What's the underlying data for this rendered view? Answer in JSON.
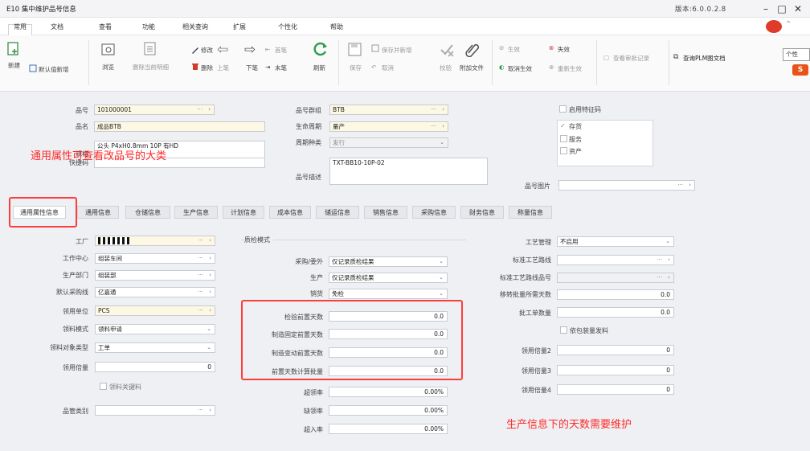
{
  "window": {
    "title": "E10 集中维护品号信息",
    "version": "版本:6.0.0.2.8",
    "min": "–",
    "max": "□",
    "close": "✕"
  },
  "menu": [
    "常用",
    "文档",
    "查看",
    "功能",
    "相关查询",
    "扩展",
    "个性化",
    "帮助"
  ],
  "ribbon": {
    "new": "新建",
    "default_new": "默认值新增",
    "browse": "浏览",
    "delete_current": "删除当前明细",
    "edit": "修改",
    "delete": "删除",
    "prev": "上笔",
    "next": "下笔",
    "first": "首笔",
    "last": "末笔",
    "refresh": "刷新",
    "save": "保存",
    "save_new": "保存并新增",
    "cancel": "取消",
    "check": "校验",
    "attach": "附加文件",
    "effective": "生效",
    "cancel_effective": "取消生效",
    "invalid": "失效",
    "re_effective": "重新生效",
    "view_audit": "查看审批记录",
    "query_plm": "查询PLM图文档",
    "tooltip": "个性"
  },
  "form": {
    "item_no_label": "品号",
    "item_no": "101000001",
    "item_name_label": "品名",
    "item_name": "成品BTB",
    "spec_label": "规格",
    "spec": "公头 P4xH0.8mm 10P 有HD",
    "quick_label": "快捷码",
    "quick": "",
    "group_label": "品号群组",
    "group": "BTB",
    "lifecycle_label": "生命周期",
    "lifecycle": "量产",
    "cycle_type_label": "周期种类",
    "cycle_type": "发行",
    "desc_label": "品号描述",
    "desc": "TXT-BB10-10P-02",
    "feature_label": "启用特征码",
    "stock_label": "存货",
    "service_label": "服务",
    "asset_label": "资产",
    "picture_label": "品号图片"
  },
  "annotation_top": "通用属性可查看改品号的大类",
  "annotation_bottom": "生产信息下的天数需要维护",
  "tabs": [
    "通用属性信息",
    "通用信息",
    "仓储信息",
    "生产信息",
    "计划信息",
    "成本信息",
    "储运信息",
    "销售信息",
    "采购信息",
    "财务信息",
    "称量信息"
  ],
  "prod": {
    "factory_label": "工厂",
    "factory": "",
    "work_center_label": "工作中心",
    "work_center": "组装车间",
    "dept_label": "生产部门",
    "dept": "组装部",
    "line_label": "默认采购线",
    "line": "亿嘉通",
    "unit_label": "领用单位",
    "unit": "PCS",
    "pick_mode_label": "领料模式",
    "pick_mode": "领料申请",
    "pick_type_label": "领料对象类型",
    "pick_type": "工单",
    "multiple_label": "领用倍量",
    "multiple": "0",
    "key_pick_label": "领料关键料",
    "mgmt_label": "品管类别",
    "mgmt": "",
    "qc_mode_label": "质检模式",
    "purchase_label": "采购/委外",
    "purchase": "仅记录质检结果",
    "production_label": "生产",
    "production": "仅记录质检结果",
    "sales_label": "销货",
    "sales": "免检",
    "inspect_days_label": "检验前置天数",
    "inspect_days": "0.0",
    "fixed_days_label": "制造固定前置天数",
    "fixed_days": "0.0",
    "var_days_label": "制造变动前置天数",
    "var_days": "0.0",
    "batch_label": "前置天数计算批量",
    "batch": "0.0",
    "over_label": "超领率",
    "over": "0.00%",
    "short_label": "缺领率",
    "short": "0.00%",
    "in_label": "超入率",
    "in": "0.00%",
    "process_mgmt_label": "工艺管理",
    "process_mgmt": "不启用",
    "std_route_label": "标准工艺路线",
    "std_route": "",
    "std_route_no_label": "标准工艺路线品号",
    "std_route_no": "",
    "move_days_label": "移转批量所需天数",
    "move_days": "0.0",
    "batch_qty_label": "批工单数量",
    "batch_qty": "0.0",
    "dep_label": "依包装量发料",
    "m2_label": "领用倍量2",
    "m2": "0",
    "m3_label": "领用倍量3",
    "m3": "0",
    "m4_label": "领用倍量4",
    "m4": "0"
  }
}
